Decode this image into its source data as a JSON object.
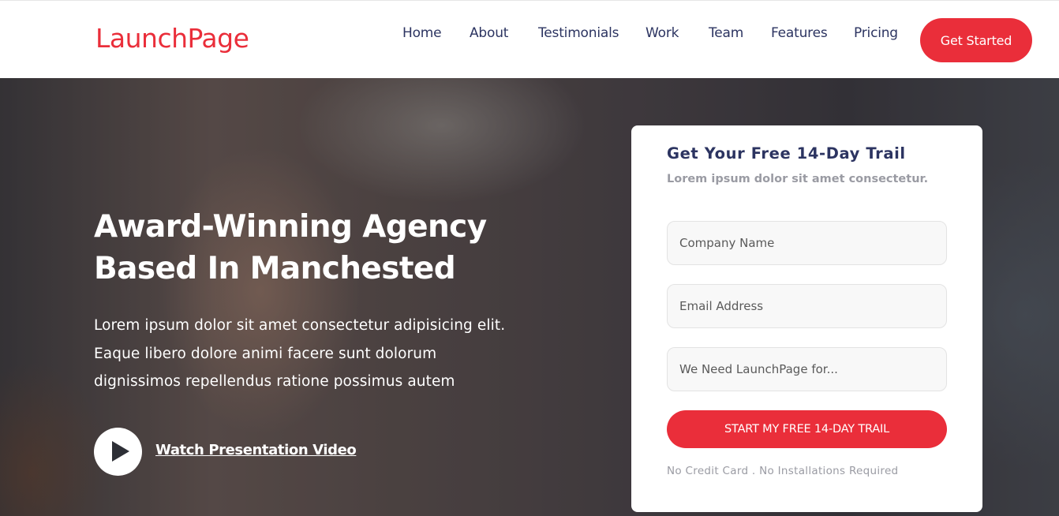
{
  "brand": {
    "logo": "LaunchPage",
    "accent": "#ea2e3a",
    "text_dark": "#2c3461"
  },
  "nav": {
    "items": [
      {
        "label": "Home"
      },
      {
        "label": "About"
      },
      {
        "label": "Testimonials"
      },
      {
        "label": "Work"
      },
      {
        "label": "Team"
      },
      {
        "label": "Features"
      },
      {
        "label": "Pricing"
      }
    ],
    "cta_label": "Get Started"
  },
  "hero": {
    "title_line1": "Award-Winning Agency",
    "title_line2": "Based In Manchested",
    "text_line1": "Lorem ipsum dolor sit amet consectetur adipisicing elit.",
    "text_line2": "Eaque libero dolore animi facere sunt dolorum",
    "text_line3": "dignissimos repellendus ratione possimus autem",
    "play_icon": "play-icon",
    "video_link": "Watch Presentation Video"
  },
  "signup": {
    "title": "Get Your Free 14-Day Trail",
    "subtitle": "Lorem ipsum dolor sit amet consectetur.",
    "fields": [
      {
        "placeholder": "Company Name",
        "value": ""
      },
      {
        "placeholder": "Email Address",
        "value": ""
      },
      {
        "placeholder": "We Need LaunchPage for...",
        "value": ""
      }
    ],
    "submit_label": "START MY FREE 14-DAY TRAIL",
    "note": "No Credit Card . No Installations Required"
  }
}
